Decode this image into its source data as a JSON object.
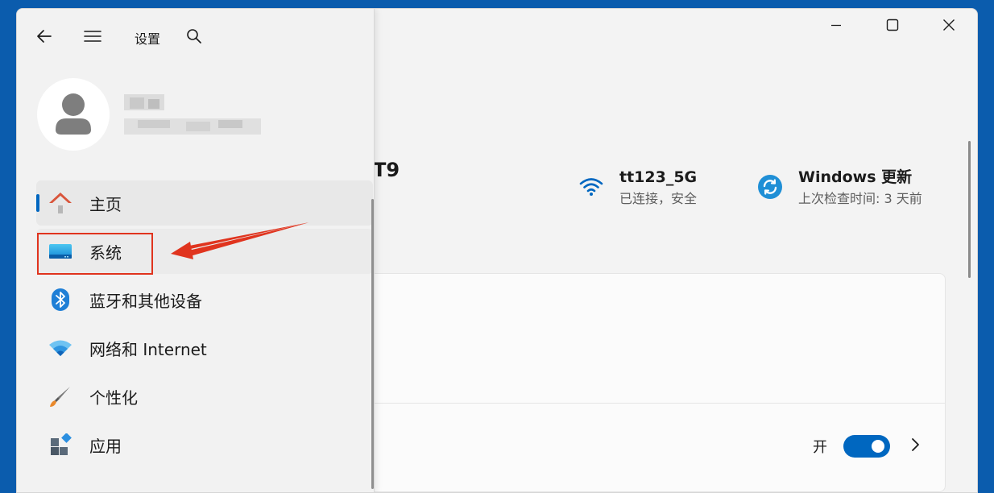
{
  "window": {
    "title": "设置",
    "caption": {
      "minimize_icon": "minimize-icon",
      "maximize_icon": "maximize-icon",
      "close_icon": "close-icon"
    }
  },
  "topbar": {
    "back_icon": "back-arrow-icon",
    "menu_icon": "hamburger-menu-icon",
    "search_icon": "search-icon"
  },
  "profile": {
    "avatar_icon": "user-avatar-icon"
  },
  "device": {
    "name_fragment": "T9"
  },
  "status": {
    "wifi": {
      "title": "tt123_5G",
      "subtitle": "已连接，安全",
      "icon": "wifi-icon"
    },
    "update": {
      "title": "Windows 更新",
      "subtitle": "上次检查时间: 3 天前",
      "icon": "sync-icon"
    }
  },
  "nav": {
    "items": [
      {
        "label": "主页",
        "icon": "home-icon"
      },
      {
        "label": "系统",
        "icon": "system-display-icon"
      },
      {
        "label": "蓝牙和其他设备",
        "icon": "bluetooth-icon"
      },
      {
        "label": "网络和 Internet",
        "icon": "wifi-network-icon"
      },
      {
        "label": "个性化",
        "icon": "paintbrush-icon"
      },
      {
        "label": "应用",
        "icon": "apps-icon"
      }
    ]
  },
  "card": {
    "toggle_label": "开",
    "toggle_on": true,
    "chevron_icon": "chevron-right-icon"
  },
  "colors": {
    "accent": "#0067c0",
    "annotation": "#e0341e",
    "desktop": "#0b5cad"
  }
}
